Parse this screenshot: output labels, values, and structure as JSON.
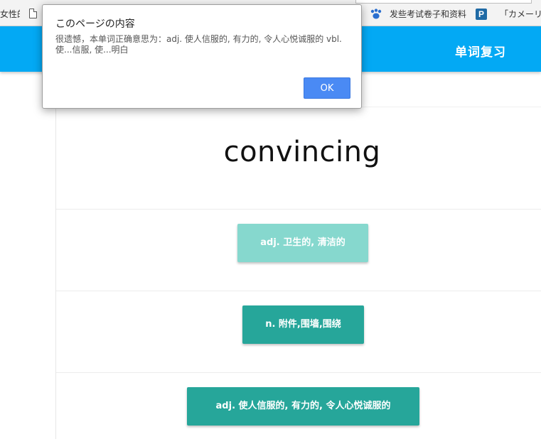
{
  "bookmarks": {
    "item_1": "女性的",
    "item_2": "发些考试卷子和资料",
    "item_3": "「カメーリス"
  },
  "header": {
    "title": "单词复习"
  },
  "quiz": {
    "word": "convincing",
    "options": [
      {
        "label": "adj. 卫生的, 清洁的",
        "color": "#86d8ce"
      },
      {
        "label": "n. 附件,围墙,围绕",
        "color": "#26a69a"
      },
      {
        "label": "adj. 使人信服的, 有力的, 令人心悦诚服的",
        "color": "#26a69a"
      }
    ]
  },
  "alert": {
    "title": "このページの内容",
    "message": "很遗憾，本单词正确意思为：adj. 使人信服的, 有力的, 令人心悦诚服的 vbl. 使...信服, 使...明白",
    "ok_label": "OK"
  },
  "colors": {
    "header_bg": "#03a9f4",
    "option_teal": "#26a69a",
    "option_light_teal": "#86d8ce",
    "dialog_button": "#4a8af4"
  }
}
